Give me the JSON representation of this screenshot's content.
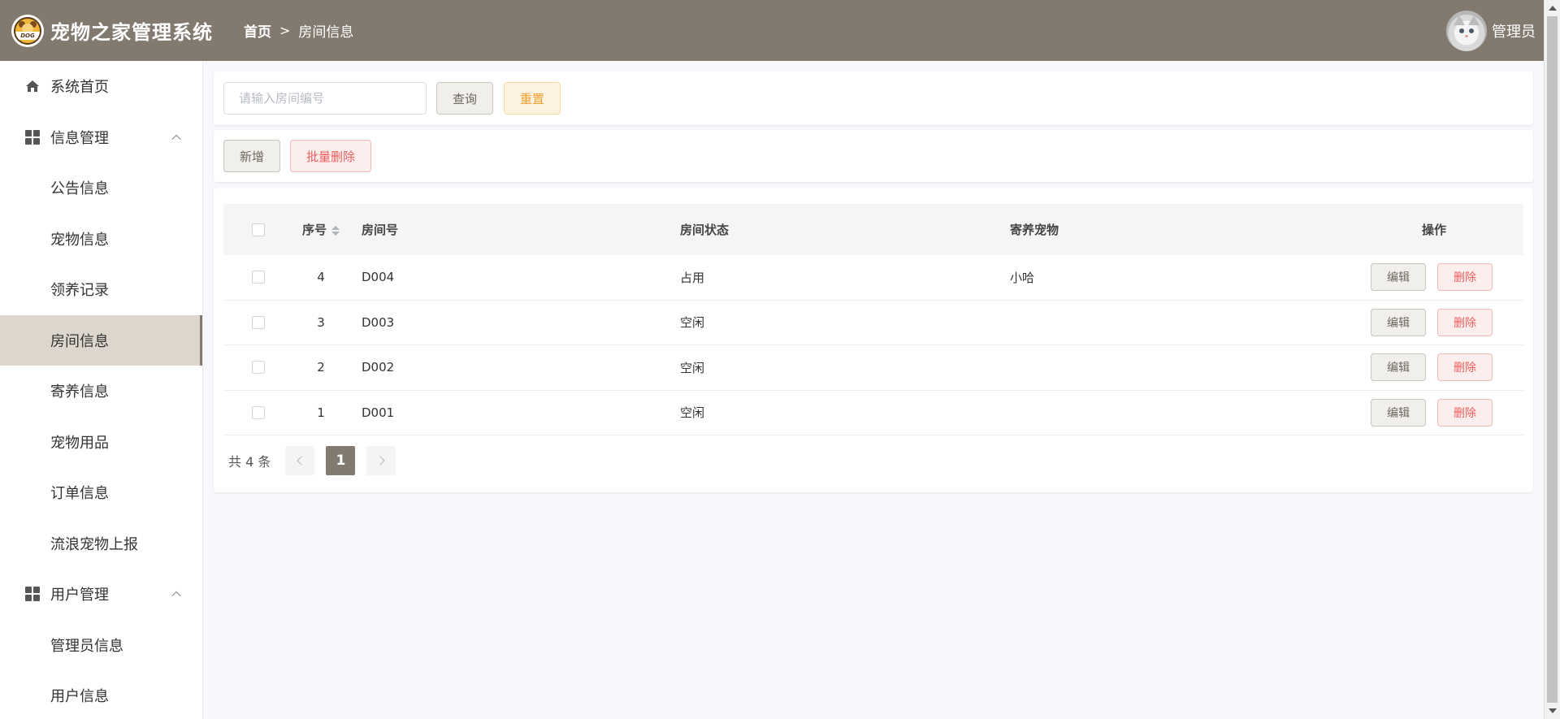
{
  "header": {
    "app_title": "宠物之家管理系统",
    "logo_text": "DOG",
    "breadcrumb_home": "首页",
    "breadcrumb_separator": ">",
    "breadcrumb_current": "房间信息",
    "username": "管理员",
    "bg_color": "#827a6f"
  },
  "sidebar": {
    "items": [
      {
        "label": "系统首页",
        "icon": "home-icon",
        "type": "top"
      },
      {
        "label": "信息管理",
        "icon": "grid-icon",
        "type": "group",
        "expanded": true
      },
      {
        "label": "公告信息",
        "type": "sub"
      },
      {
        "label": "宠物信息",
        "type": "sub"
      },
      {
        "label": "领养记录",
        "type": "sub"
      },
      {
        "label": "房间信息",
        "type": "sub",
        "active": true
      },
      {
        "label": "寄养信息",
        "type": "sub"
      },
      {
        "label": "宠物用品",
        "type": "sub"
      },
      {
        "label": "订单信息",
        "type": "sub"
      },
      {
        "label": "流浪宠物上报",
        "type": "sub"
      },
      {
        "label": "用户管理",
        "icon": "grid-icon",
        "type": "group",
        "expanded": true
      },
      {
        "label": "管理员信息",
        "type": "sub"
      },
      {
        "label": "用户信息",
        "type": "sub"
      }
    ]
  },
  "search": {
    "placeholder": "请输入房间编号",
    "value": "",
    "query_label": "查询",
    "reset_label": "重置"
  },
  "actions": {
    "add_label": "新增",
    "batch_delete_label": "批量删除"
  },
  "table": {
    "columns": [
      "序号",
      "房间号",
      "房间状态",
      "寄养宠物",
      "操作"
    ],
    "rows": [
      {
        "no": "4",
        "room": "D004",
        "status": "占用",
        "pet": "小哈"
      },
      {
        "no": "3",
        "room": "D003",
        "status": "空闲",
        "pet": ""
      },
      {
        "no": "2",
        "room": "D002",
        "status": "空闲",
        "pet": ""
      },
      {
        "no": "1",
        "room": "D001",
        "status": "空闲",
        "pet": ""
      }
    ],
    "edit_label": "编辑",
    "delete_label": "删除"
  },
  "pagination": {
    "total_text": "共 4 条",
    "current_page": "1"
  },
  "colors": {
    "accent": "#827a6f",
    "active_menu_bg": "#dcd6cd",
    "danger": "#ee5d5d",
    "warning": "#f0a030"
  }
}
